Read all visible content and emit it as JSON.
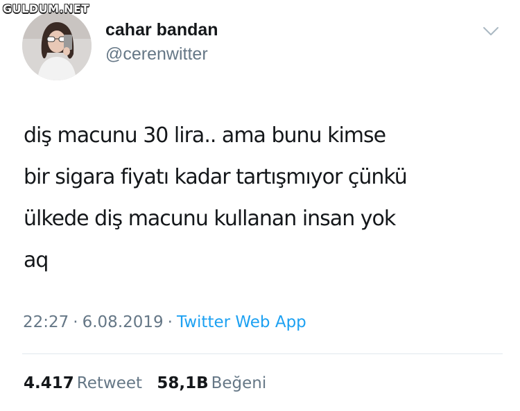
{
  "watermark": "GULDUM.NET",
  "author": {
    "display_name": "cahar bandan",
    "handle": "@cerenwitter"
  },
  "menu_icon": "chevron-down-icon",
  "tweet": {
    "lines": [
      "diş macunu 30 lira.. ama bunu kimse",
      "bir sigara fiyatı kadar tartışmıyor çünkü",
      "ülkede diş macunu kullanan insan yok",
      "aq"
    ],
    "time": "22:27",
    "separator": "·",
    "date": "6.08.2019",
    "source": "Twitter Web App"
  },
  "stats": {
    "retweet_count": "4.417",
    "retweet_label": "Retweet",
    "like_count": "58,1B",
    "like_label": "Beğeni"
  },
  "colors": {
    "text": "#14171a",
    "secondary": "#657786",
    "link": "#1da1f2",
    "divider": "#e1e8ed"
  }
}
